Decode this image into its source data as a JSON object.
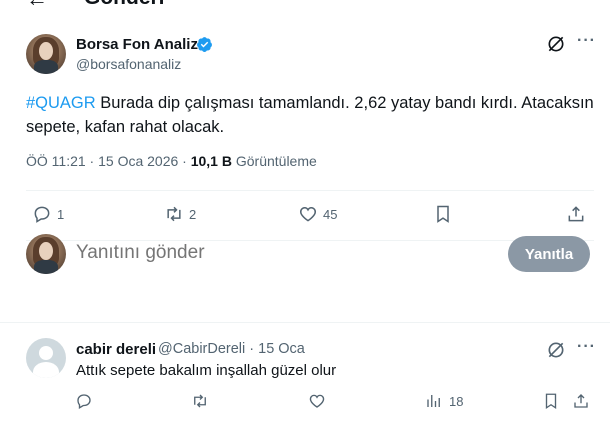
{
  "header": {
    "back_glyph": "←",
    "title": "Gönderi"
  },
  "tweet": {
    "author_name": "Borsa Fon Analiz",
    "author_handle": "@borsafonanaliz",
    "hashtag": "#QUAGR",
    "text": " Burada dip çalışması tamamlandı. 2,62 yatay bandı kırdı. Atacaksın sepete, kafan rahat olacak.",
    "time": "ÖÖ 11:21 · 15 Oca 2026 · ",
    "views_count": "10,1 B",
    "views_label": " Görüntüleme",
    "more_glyph": "···",
    "actions": {
      "replies": "1",
      "reposts": "2",
      "likes": "45"
    },
    "icons": [
      "grok-icon",
      "reply-icon",
      "retweet-icon",
      "like-icon",
      "bookmark-icon",
      "share-icon",
      "verified-badge-icon"
    ]
  },
  "reply_box": {
    "placeholder": "Yanıtını gönder",
    "button_label": "Yanıtla"
  },
  "reply": {
    "author_name": "cabir dereli",
    "author_handle": "@CabirDereli · 15 Oca",
    "text": "Attık sepete bakalım inşallah güzel olur",
    "more_glyph": "···",
    "actions": {
      "views": "18"
    }
  },
  "colors": {
    "accent": "#1d9bf0",
    "muted": "#536471",
    "button_disabled": "#8b98a5"
  }
}
